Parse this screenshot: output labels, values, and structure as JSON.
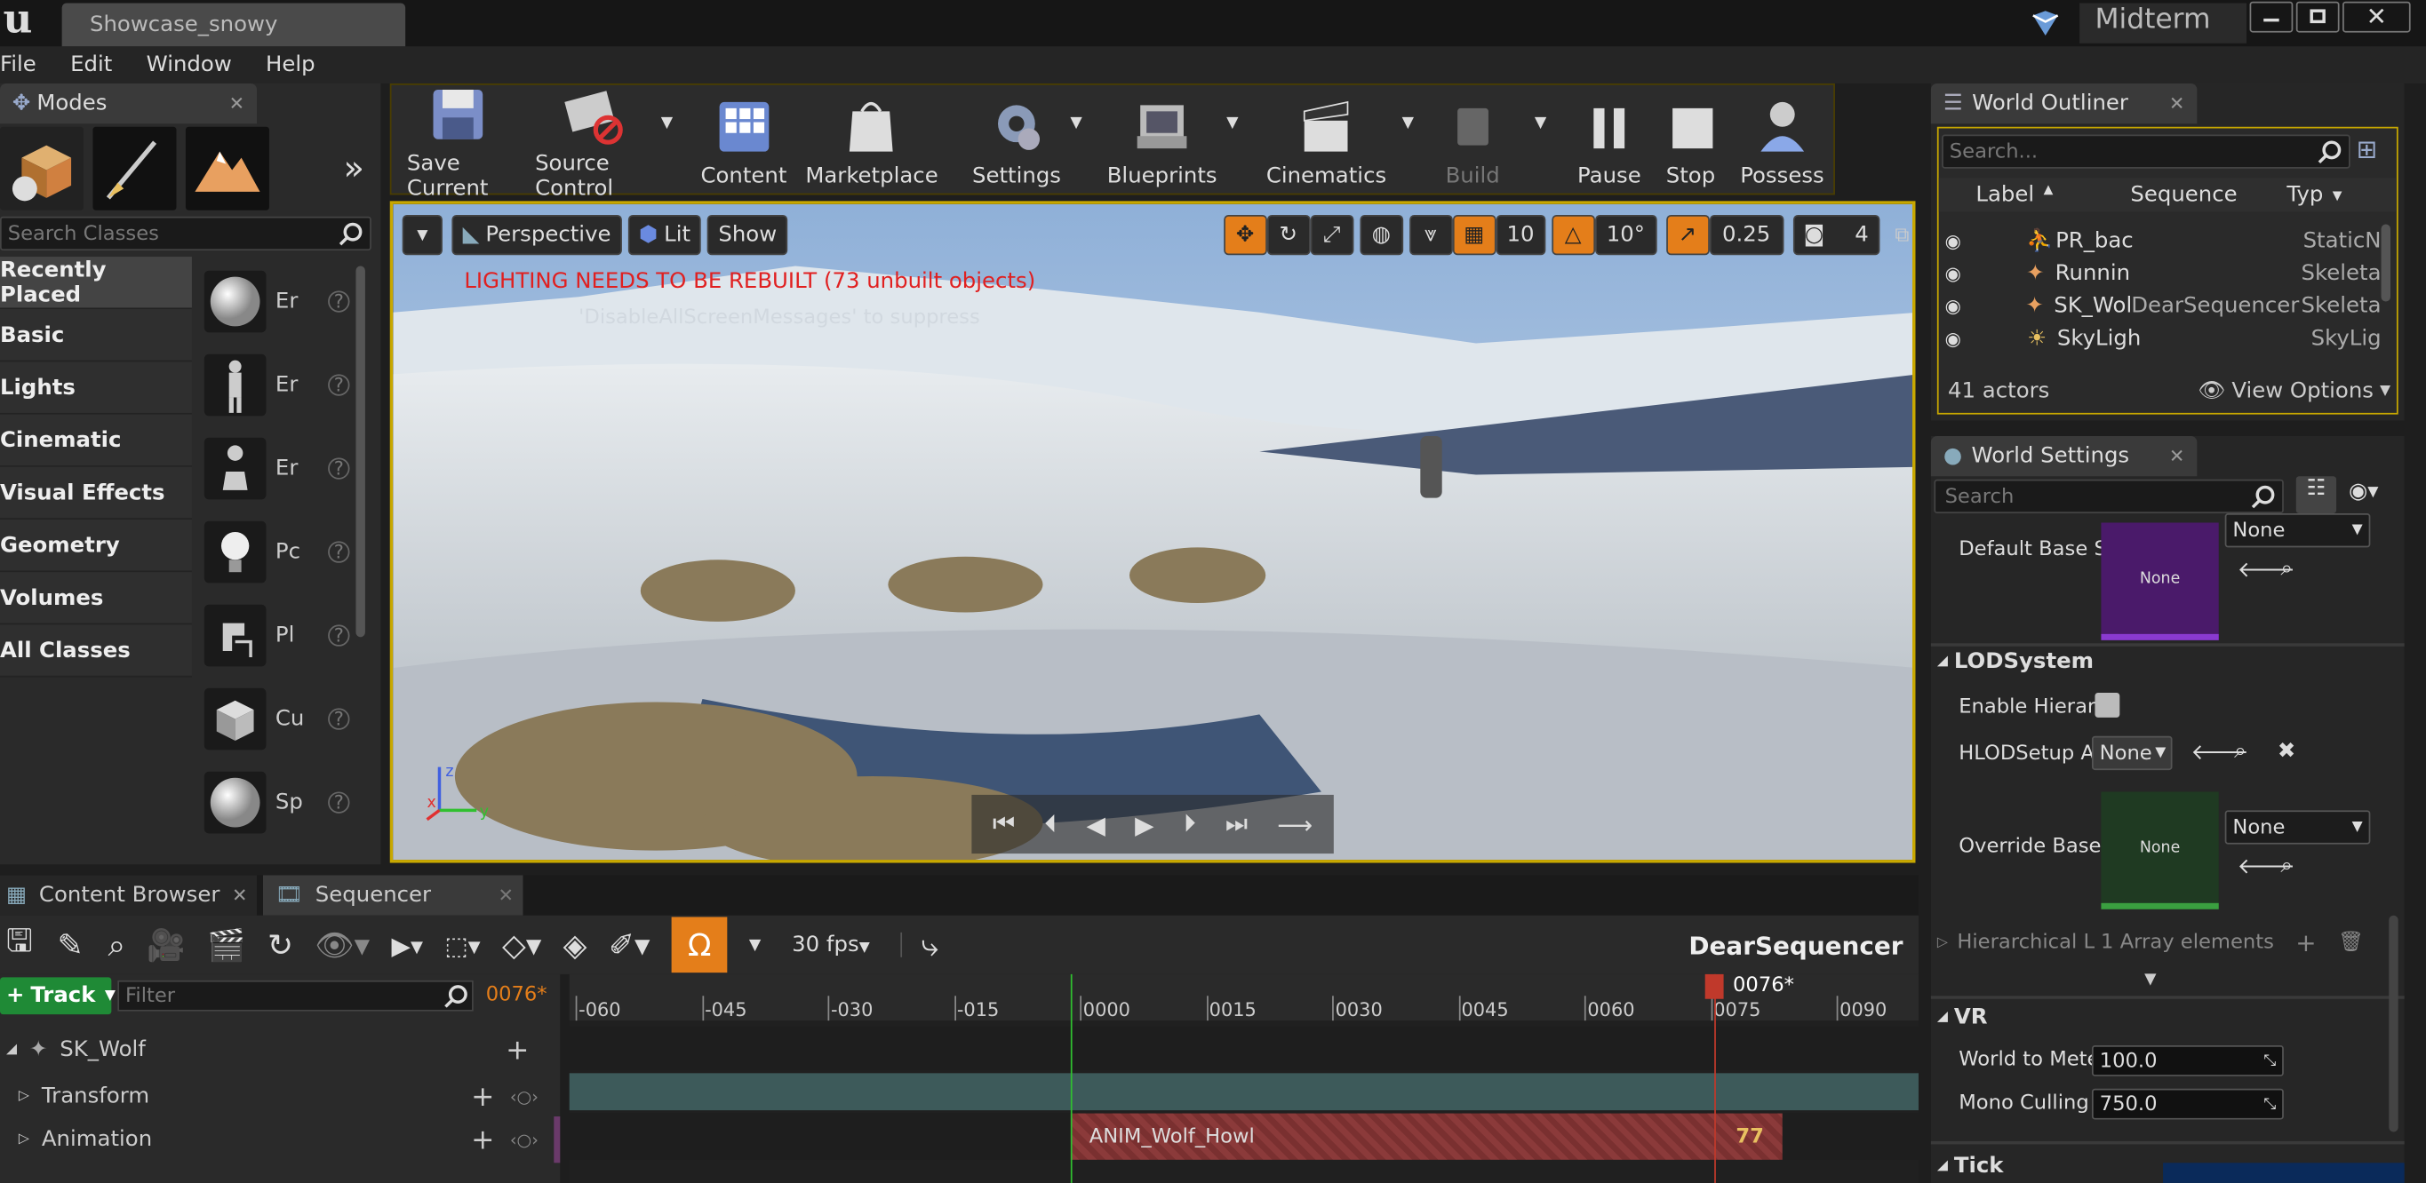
{
  "window": {
    "logo": "u",
    "tab_title": "Showcase_snowy",
    "project_name": "Midterm"
  },
  "menu": [
    "File",
    "Edit",
    "Window",
    "Help"
  ],
  "modes": {
    "tab_label": "Modes",
    "search_placeholder": "Search Classes",
    "categories": [
      "Recently Placed",
      "Basic",
      "Lights",
      "Cinematic",
      "Visual Effects",
      "Geometry",
      "Volumes",
      "All Classes"
    ],
    "class_items": [
      "Er",
      "Er",
      "Er",
      "Pc",
      "Pl",
      "Cu",
      "Sp"
    ]
  },
  "toolbar": {
    "buttons": [
      "Save Current",
      "Source Control",
      "Content",
      "Marketplace",
      "Settings",
      "Blueprints",
      "Cinematics",
      "Build",
      "Pause",
      "Stop",
      "Possess"
    ]
  },
  "viewport": {
    "perspective_label": "Perspective",
    "lit_label": "Lit",
    "show_label": "Show",
    "grid_snap": "10",
    "rot_snap": "10°",
    "scale_snap": "0.25",
    "camera_speed": "4",
    "warning": "LIGHTING NEEDS TO BE REBUILT (73 unbuilt objects)",
    "warning_sub": "'DisableAllScreenMessages' to suppress"
  },
  "outliner": {
    "tab_label": "World Outliner",
    "search_placeholder": "Search...",
    "columns": [
      "Label",
      "Sequence",
      "Typ"
    ],
    "rows": [
      {
        "label": "PR_bac",
        "sequence": "",
        "type": "StaticN"
      },
      {
        "label": "Runnin",
        "sequence": "",
        "type": "Skeleta"
      },
      {
        "label": "SK_Wol",
        "sequence": "DearSequencer",
        "type": "Skeleta"
      },
      {
        "label": "SkyLigh",
        "sequence": "",
        "type": "SkyLig"
      }
    ],
    "actor_count": "41 actors",
    "view_options": "View Options"
  },
  "settings": {
    "tab_label": "World Settings",
    "search_placeholder": "Search",
    "default_base_label": "Default Base S",
    "none_label": "None",
    "lod_section": "LODSystem",
    "enable_hier_label": "Enable Hierarc",
    "hlod_label": "HLODSetup As",
    "override_label": "Override Base",
    "hier_label": "Hierarchical L",
    "array_label": "1 Array elements",
    "vr_section": "VR",
    "world_to_meters_label": "World to Meter",
    "world_to_meters_value": "100.0",
    "mono_culling_label": "Mono Culling D",
    "mono_culling_value": "750.0",
    "tick_section": "Tick"
  },
  "bottom_tabs": [
    "Content Browser",
    "Sequencer"
  ],
  "sequencer": {
    "fps": "30 fps",
    "name": "DearSequencer",
    "track_button": "Track",
    "filter_placeholder": "Filter",
    "current_frame": "0076*",
    "ticks": [
      "-060",
      "-045",
      "-030",
      "-015",
      "0000",
      "0015",
      "0030",
      "0045",
      "0060",
      "0075",
      "0090"
    ],
    "tracks": [
      {
        "label": "SK_Wolf"
      },
      {
        "label": "Transform"
      },
      {
        "label": "Animation"
      }
    ],
    "anim_clip": "ANIM_Wolf_Howl",
    "clip_end": "77"
  },
  "colors": {
    "accent": "#c8a800",
    "orange": "#e47e1a",
    "warning_red": "#e02020",
    "playhead": "#c0392b",
    "clip": "#8b3a3a"
  }
}
